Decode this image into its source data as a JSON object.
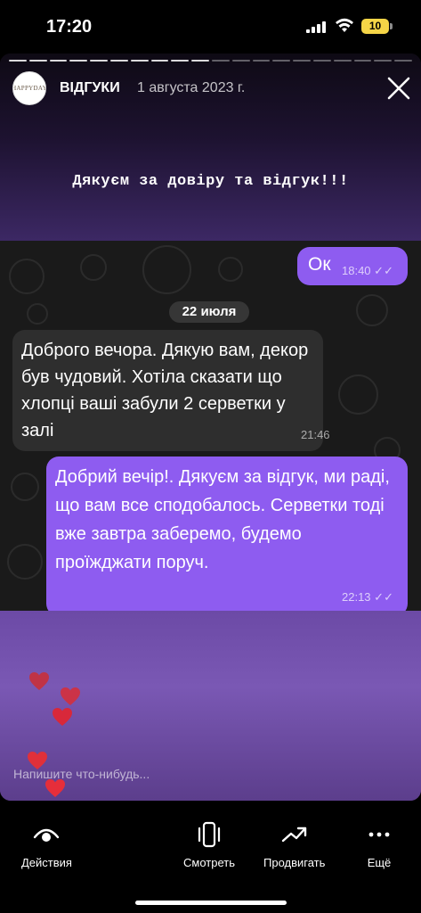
{
  "status_bar": {
    "time": "17:20",
    "battery": "10",
    "icons": [
      "signal-icon",
      "wifi-icon",
      "battery-icon"
    ]
  },
  "story": {
    "account_name": "ВІДГУКИ",
    "date": "1 августа 2023 г.",
    "avatar_logo": "HAPPYDAY",
    "headline": "Дякуєм за довіру та  відгук!!!",
    "close_icon": "close-icon",
    "reply_placeholder": "Напишите что-нибудь...",
    "heart_icon": "heart-icon"
  },
  "chat": {
    "messages": [
      {
        "direction": "outgoing",
        "text": "Ок",
        "time": "18:40"
      },
      {
        "direction": "incoming",
        "text": "Доброго вечора. Дякую вам, декор був чудовий. Хотіла сказати що хлопці ваші забули 2 серветки у залі",
        "time": "21:46"
      },
      {
        "direction": "outgoing",
        "text": "Добрий вечір!. Дякуєм за відгук, ми раді, що вам все сподобалось. Серветки тоді вже завтра заберемо, будемо проїжджати поруч.",
        "time": "22:13"
      }
    ],
    "date_separator": "22 июля",
    "read_icon": "double-check-icon"
  },
  "bottom_nav": {
    "items": [
      {
        "label": "Действия",
        "icon": "eye-icon"
      },
      {
        "label": "Смотреть",
        "icon": "device-view-icon"
      },
      {
        "label": "Продвигать",
        "icon": "trend-up-icon"
      },
      {
        "label": "Ещё",
        "icon": "more-dots-icon"
      }
    ]
  },
  "colors": {
    "outgoing_bubble": "#8e5cf0",
    "incoming_bubble": "#2e2e2e",
    "battery": "#f5d547",
    "heart": "#e0303a"
  }
}
